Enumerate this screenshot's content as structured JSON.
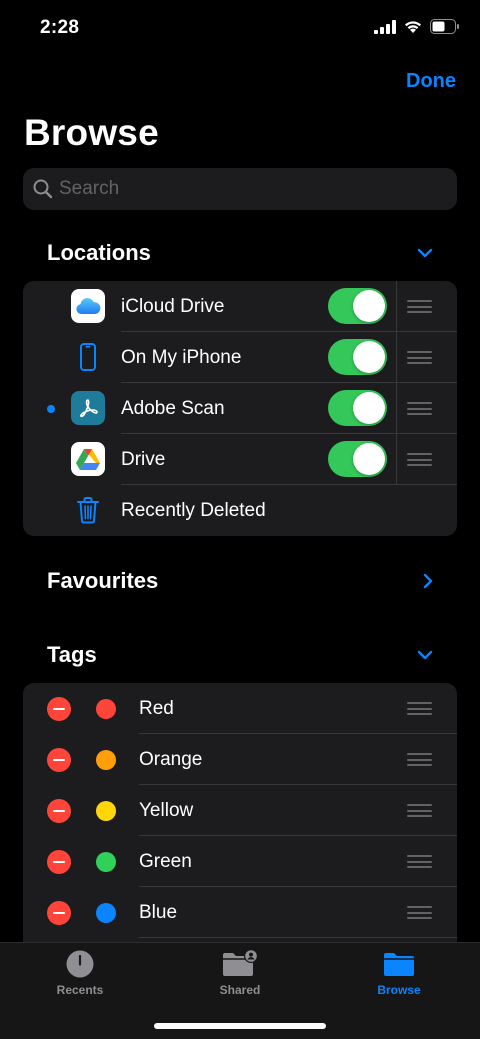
{
  "status_bar": {
    "time": "2:28"
  },
  "header": {
    "done_label": "Done",
    "title": "Browse"
  },
  "search": {
    "placeholder": "Search"
  },
  "locations": {
    "title": "Locations",
    "items": [
      {
        "label": "iCloud Drive",
        "icon": "icloud-icon",
        "enabled": true
      },
      {
        "label": "On My iPhone",
        "icon": "iphone-icon",
        "enabled": true
      },
      {
        "label": "Adobe Scan",
        "icon": "adobe-scan-icon",
        "enabled": true,
        "selected": true
      },
      {
        "label": "Drive",
        "icon": "google-drive-icon",
        "enabled": true
      },
      {
        "label": "Recently Deleted",
        "icon": "trash-icon"
      }
    ]
  },
  "favourites": {
    "title": "Favourites"
  },
  "tags": {
    "title": "Tags",
    "items": [
      {
        "label": "Red",
        "color": "#ff453a"
      },
      {
        "label": "Orange",
        "color": "#ff9f0a"
      },
      {
        "label": "Yellow",
        "color": "#ffd60a"
      },
      {
        "label": "Green",
        "color": "#30d158"
      },
      {
        "label": "Blue",
        "color": "#0a84ff"
      }
    ]
  },
  "tabbar": {
    "tabs": [
      {
        "label": "Recents",
        "icon": "clock-icon",
        "active": false
      },
      {
        "label": "Shared",
        "icon": "shared-folder-icon",
        "active": false
      },
      {
        "label": "Browse",
        "icon": "folder-icon",
        "active": true
      }
    ]
  },
  "colors": {
    "accent": "#0a84ff",
    "toggle_on": "#34c759",
    "delete": "#ff453a"
  }
}
